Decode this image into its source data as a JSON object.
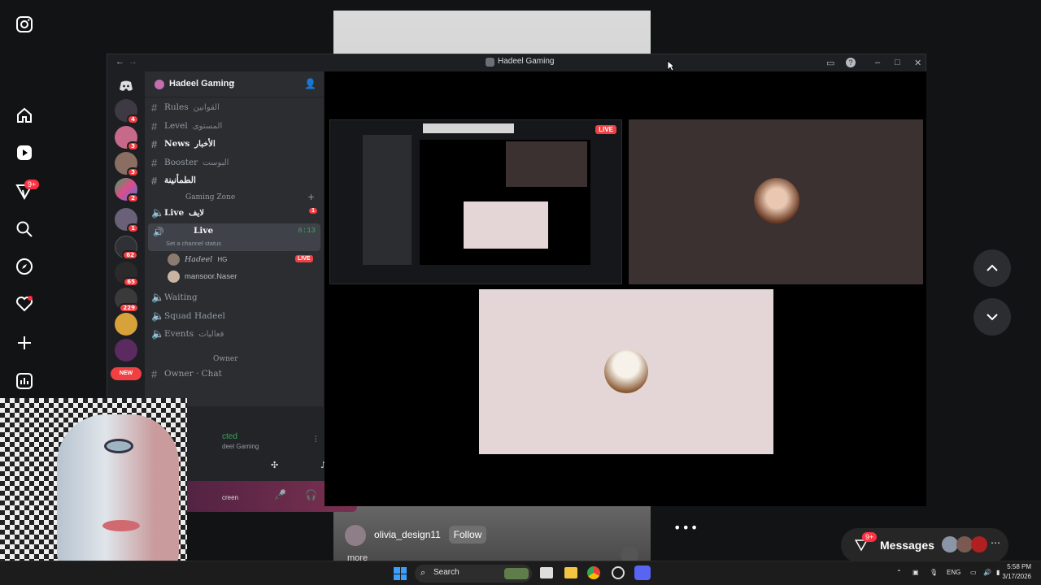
{
  "window": {
    "title": "Hadeel Gaming"
  },
  "server": {
    "name": "Hadeel Gaming"
  },
  "guild_badges": [
    "4",
    "3",
    "3",
    "2",
    "1",
    "62",
    "65",
    "229",
    "NEW"
  ],
  "channels": [
    {
      "name": "Rules",
      "suffix": "القوانين"
    },
    {
      "name": "Level",
      "suffix": "المستوى"
    },
    {
      "name": "News",
      "suffix": "الأخبار"
    },
    {
      "name": "Booster",
      "suffix": "البوست"
    },
    {
      "name": "الطمأنينة"
    }
  ],
  "category_gaming": "Gaming Zone",
  "voice": {
    "live_channel": {
      "name": "Live",
      "suffix": "لايف",
      "badge": "1"
    },
    "active": {
      "name": "Live",
      "time": "6:13",
      "status": "Set a channel status"
    },
    "users": [
      {
        "name": "Hadeel",
        "tag": "HG",
        "live": "LIVE"
      },
      {
        "name": "mansoor.Naser"
      }
    ],
    "others": [
      "Waiting",
      "Squad Hadeel",
      "Events"
    ],
    "events_suffix": "فعاليات"
  },
  "category_owner": "Owner",
  "owner_chat": "Owner · Chat",
  "panel": {
    "connected": "cted",
    "server": "deel Gaming",
    "screen": "creen"
  },
  "stage": {
    "live": "LIVE"
  },
  "instagram": {
    "notif_badge": "9+",
    "reel_user": "olivia_design11",
    "follow": "Follow",
    "more": "more",
    "messages": "Messages",
    "messages_badge": "9+"
  },
  "taskbar": {
    "search": "Search",
    "lang": "ENG",
    "time": "5:58 PM",
    "date": "3/17/2026"
  }
}
